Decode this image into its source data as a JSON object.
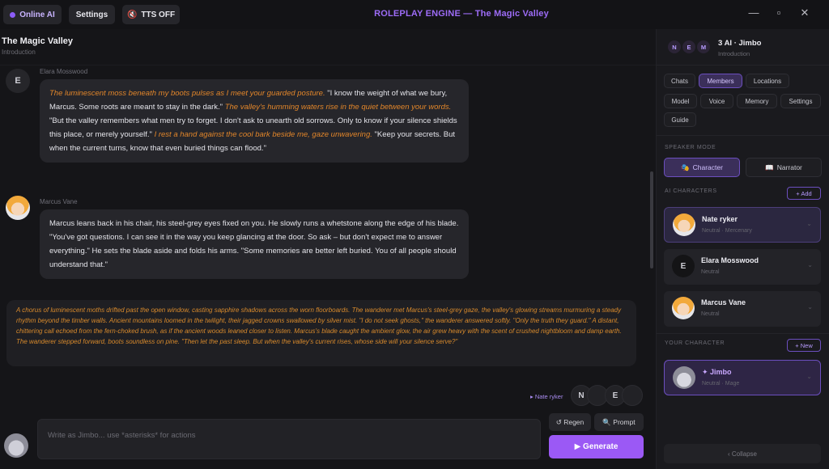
{
  "topbar": {
    "online_label": "Online AI",
    "settings_label": "Settings",
    "tts_label": "TTS OFF",
    "app_title": "ROLEPLAY ENGINE — The Magic Valley",
    "minimize": "—",
    "maximize": "▫",
    "close": "✕"
  },
  "scene": {
    "title": "The Magic Valley",
    "subtitle": "Introduction"
  },
  "messages": [
    {
      "sender": "Elara Mosswood",
      "avatar_letter": "E",
      "segments": [
        {
          "type": "action",
          "text": "The luminescent moss beneath my boots pulses as I meet your guarded posture."
        },
        {
          "type": "speech",
          "text": " \"I know the weight of what we bury, Marcus. Some roots are meant to stay in the dark.\" "
        },
        {
          "type": "action",
          "text": "The valley's humming waters rise in the quiet between your words."
        },
        {
          "type": "speech",
          "text": " \"But the valley remembers what men try to forget. I don't ask to unearth old sorrows. Only to know if your silence shields this place, or merely yourself.\" "
        },
        {
          "type": "action",
          "text": "I rest a hand against the cool bark beside me, gaze unwavering."
        },
        {
          "type": "speech",
          "text": " \"Keep your secrets. But when the current turns, know that even buried things can flood.\""
        }
      ]
    },
    {
      "sender": "Marcus Vane",
      "segments": [
        {
          "type": "speech",
          "text": "Marcus leans back in his chair, his steel-grey eyes fixed on you. He slowly runs a whetstone along the edge of his blade. \"You've got questions. I can see it in the way you keep glancing at the door. So ask – but don't expect me to answer everything.\" He sets the blade aside and folds his arms. \"Some memories are better left buried. You of all people should understand that.\""
        }
      ]
    }
  ],
  "narration": "A chorus of luminescent moths drifted past the open window, casting sapphire shadows across the worn floorboards. The wanderer met Marcus's steel-grey gaze, the valley's glowing streams murmuring a steady rhythm beyond the timber walls. Ancient mountains loomed in the twilight, their jagged crowns swallowed by silver mist. \"I do not seek ghosts,\" the wanderer answered softly. \"Only the truth they guard.\" A distant, chittering call echoed from the fern-choked brush, as if the ancient woods leaned closer to listen. Marcus's blade caught the ambient glow, the air grew heavy with the scent of crushed nightbloom and damp earth. The wanderer stepped forward, boots soundless on pine. \"Then let the past sleep. But when the valley's current rises, whose side will your silence serve?\"",
  "speaker_bar": {
    "label": "▸ Nate ryker",
    "chips": [
      "N",
      "",
      "E",
      ""
    ]
  },
  "composer": {
    "placeholder": "Write as Jimbo... use *asterisks* for actions",
    "regen_label": "↺ Regen",
    "prompt_label": "🔍 Prompt",
    "generate_label": "▶ Generate"
  },
  "sidebar": {
    "group_letters": [
      "N",
      "E",
      "M"
    ],
    "group_title": "3 AI · Jimbo",
    "group_subtitle": "Introduction",
    "tabs": [
      "Chats",
      "Members",
      "Locations",
      "Model",
      "Voice",
      "Memory",
      "Settings",
      "Guide"
    ],
    "active_tab": "Members",
    "speaker_mode_label": "SPEAKER MODE",
    "mode_character": "Character",
    "mode_narrator": "Narrator",
    "ai_characters_label": "AI CHARACTERS",
    "add_label": "+ Add",
    "characters": [
      {
        "name": "Nate ryker",
        "sub": "Neutral · Mercenary"
      },
      {
        "name": "Elara Mosswood",
        "sub": "Neutral",
        "letter": "E"
      },
      {
        "name": "Marcus Vane",
        "sub": "Neutral"
      }
    ],
    "your_character_label": "YOUR CHARACTER",
    "new_label": "+ New",
    "your_character": {
      "name": "✦ Jimbo",
      "sub": "Neutral · Mage"
    },
    "collapse_label": "‹ Collapse",
    "chevron": "⌄"
  },
  "colors": {
    "accent": "#9b59f5",
    "action_text": "#e2862a",
    "background": "#151518"
  }
}
